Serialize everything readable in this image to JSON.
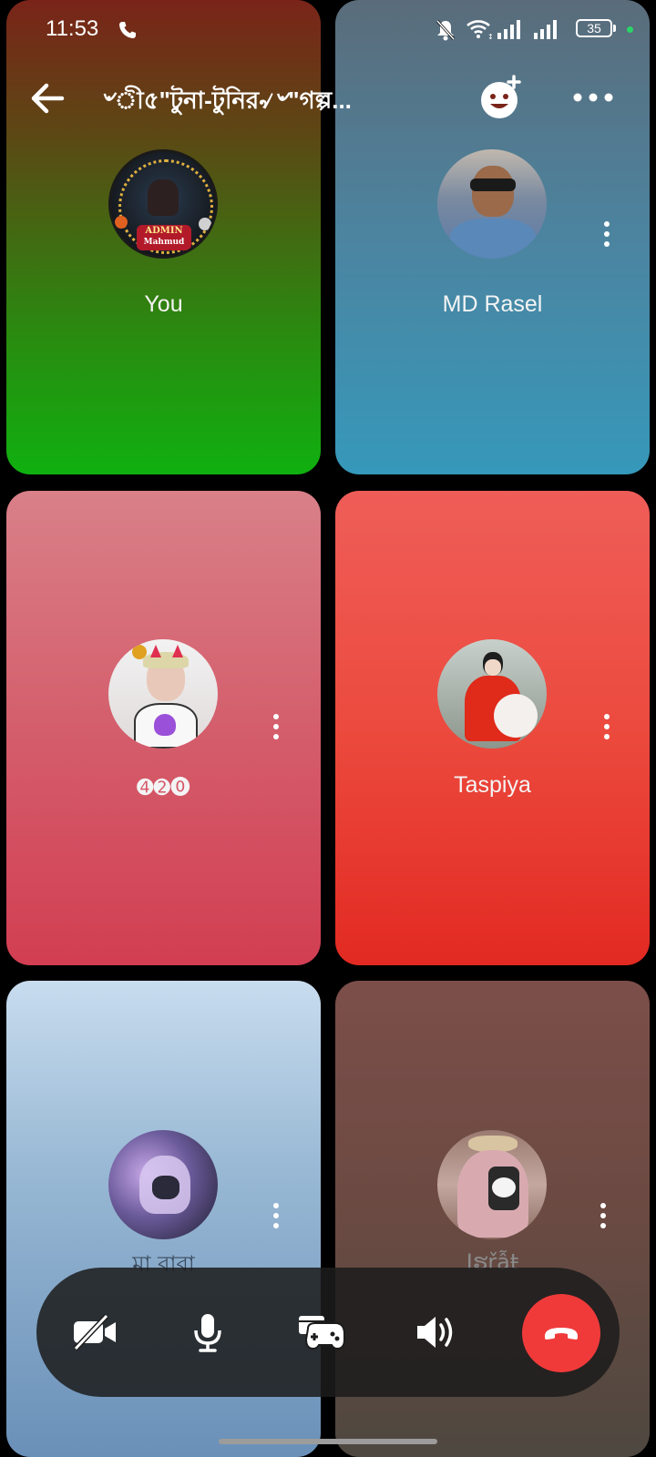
{
  "status_bar": {
    "time": "11:53",
    "battery": "35"
  },
  "header": {
    "title": "৺ী৫\"টুনা-টুনির৵৺\"গল্প..."
  },
  "participants": [
    {
      "name": "You"
    },
    {
      "name": "MD Rasel"
    },
    {
      "name": "➍➋⓿"
    },
    {
      "name": "Taspiya"
    },
    {
      "name": "মা বাবা"
    },
    {
      "name": "Iຮřẫŧ"
    }
  ],
  "avatar_badge": {
    "line1": "ADMIN",
    "line2": "Mahmud"
  },
  "call_controls": [
    "video-off-icon",
    "microphone-icon",
    "games-icon",
    "speaker-icon",
    "end-call-icon"
  ],
  "colors": {
    "end_call": "#f03a3a",
    "callbar_bg": "#1c1c1c"
  }
}
